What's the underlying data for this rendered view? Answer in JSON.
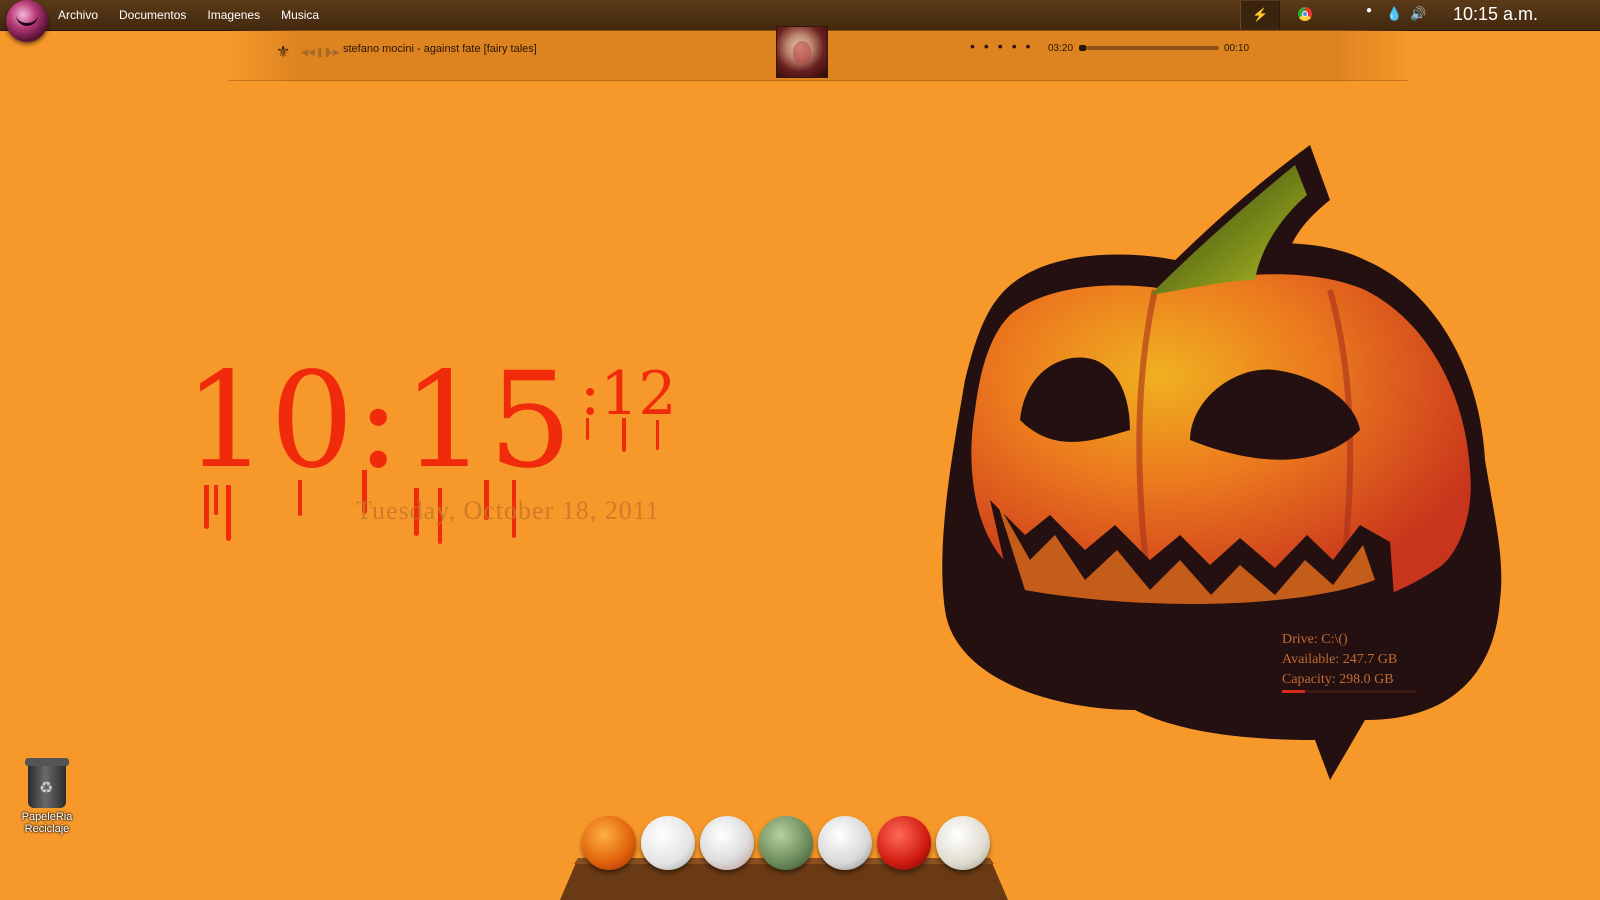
{
  "menubar": {
    "items": [
      "Archivo",
      "Documentos",
      "Imagenes",
      "Musica"
    ],
    "clock": "10:15 a.m."
  },
  "player": {
    "track": "stefano mocini - against fate [fairy tales]",
    "elapsed": "03:20",
    "remaining": "00:10",
    "progress_fraction": 0.05
  },
  "clock_widget": {
    "time": "10:15",
    "seconds": ":12",
    "date": "Tuesday, October 18, 2011",
    "color": "#ef2b0c"
  },
  "drive_widget": {
    "drive": "Drive: C:\\()",
    "available": "Available: 247.7 GB",
    "capacity": "Capacity: 298.0 GB",
    "used_fraction": 0.17
  },
  "desktop": {
    "recycle_bin_label": "PapeleRia Reciclaje"
  },
  "dock": {
    "icons": [
      "pumpkin-icon",
      "ghost-icon",
      "hockey-mask-icon",
      "zombie-icon",
      "skull-icon",
      "devil-icon",
      "mummy-icon"
    ]
  },
  "colors": {
    "background": "#f7982a",
    "menubar": "#4b2f12"
  }
}
